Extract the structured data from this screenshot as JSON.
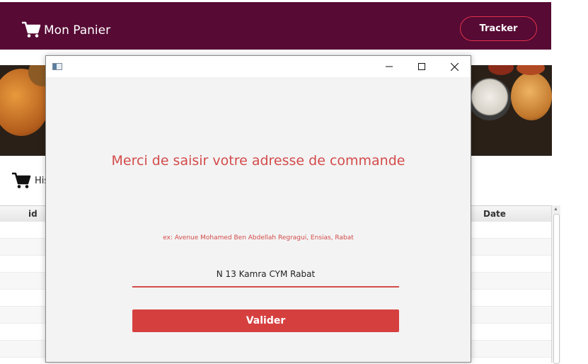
{
  "header": {
    "title": "Mon Panier",
    "tracker_label": "Tracker"
  },
  "history": {
    "label": "His"
  },
  "table": {
    "columns": [
      "id",
      "Date"
    ],
    "row_count": 8
  },
  "dialog": {
    "prompt": "Merci de saisir votre adresse de commande",
    "hint": "ex: Avenue Mohamed Ben Abdellah Regragui, Ensias, Rabat",
    "address_value": "N 13 Kamra CYM Rabat",
    "submit_label": "Valider"
  },
  "colors": {
    "header_bg": "#560a34",
    "accent": "#d44b4b",
    "button_bg": "#d5403f"
  },
  "icons": [
    "cart-icon",
    "minimize-icon",
    "maximize-icon",
    "close-icon",
    "app-window-icon"
  ]
}
